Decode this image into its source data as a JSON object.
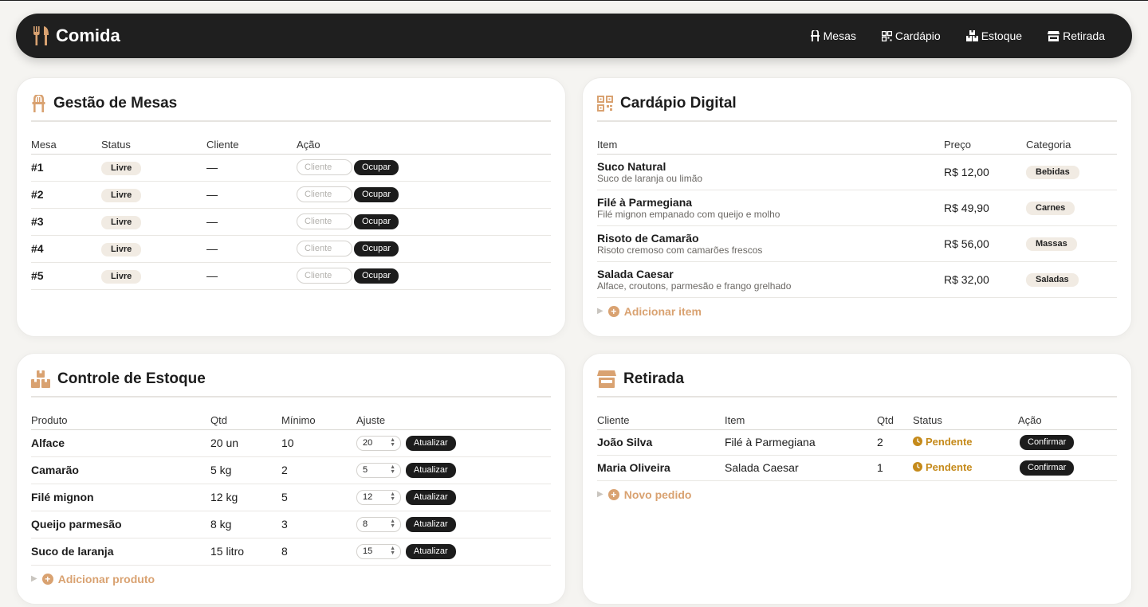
{
  "colors": {
    "accent": "#d9a271",
    "nav_bg": "#1f1f1f",
    "pending": "#c58a1a"
  },
  "nav": {
    "brand": "Comida",
    "links": [
      {
        "label": "Mesas",
        "icon": "chair-icon"
      },
      {
        "label": "Cardápio",
        "icon": "qr-grid-icon"
      },
      {
        "label": "Estoque",
        "icon": "boxes-icon"
      },
      {
        "label": "Retirada",
        "icon": "store-icon"
      }
    ]
  },
  "mesas": {
    "title": "Gestão de Mesas",
    "headers": [
      "Mesa",
      "Status",
      "Cliente",
      "Ação"
    ],
    "placeholder": "Cliente",
    "button": "Ocupar",
    "rows": [
      {
        "mesa": "#1",
        "status": "Livre",
        "cliente": "—"
      },
      {
        "mesa": "#2",
        "status": "Livre",
        "cliente": "—"
      },
      {
        "mesa": "#3",
        "status": "Livre",
        "cliente": "—"
      },
      {
        "mesa": "#4",
        "status": "Livre",
        "cliente": "—"
      },
      {
        "mesa": "#5",
        "status": "Livre",
        "cliente": "—"
      }
    ]
  },
  "cardapio": {
    "title": "Cardápio Digital",
    "headers": [
      "Item",
      "Preço",
      "Categoria"
    ],
    "add": "Adicionar item",
    "rows": [
      {
        "name": "Suco Natural",
        "desc": "Suco de laranja ou limão",
        "price": "R$ 12,00",
        "category": "Bebidas"
      },
      {
        "name": "Filé à Parmegiana",
        "desc": "Filé mignon empanado com queijo e molho",
        "price": "R$ 49,90",
        "category": "Carnes"
      },
      {
        "name": "Risoto de Camarão",
        "desc": "Risoto cremoso com camarões frescos",
        "price": "R$ 56,00",
        "category": "Massas"
      },
      {
        "name": "Salada Caesar",
        "desc": "Alface, croutons, parmesão e frango grelhado",
        "price": "R$ 32,00",
        "category": "Saladas"
      }
    ]
  },
  "estoque": {
    "title": "Controle de Estoque",
    "headers": [
      "Produto",
      "Qtd",
      "Mínimo",
      "Ajuste"
    ],
    "button": "Atualizar",
    "add": "Adicionar produto",
    "rows": [
      {
        "produto": "Alface",
        "qtd": "20 un",
        "minimo": "10",
        "ajuste": "20"
      },
      {
        "produto": "Camarão",
        "qtd": "5 kg",
        "minimo": "2",
        "ajuste": "5"
      },
      {
        "produto": "Filé mignon",
        "qtd": "12 kg",
        "minimo": "5",
        "ajuste": "12"
      },
      {
        "produto": "Queijo parmesão",
        "qtd": "8 kg",
        "minimo": "3",
        "ajuste": "8"
      },
      {
        "produto": "Suco de laranja",
        "qtd": "15 litro",
        "minimo": "8",
        "ajuste": "15"
      }
    ]
  },
  "retirada": {
    "title": "Retirada",
    "headers": [
      "Cliente",
      "Item",
      "Qtd",
      "Status",
      "Ação"
    ],
    "button": "Confirmar",
    "add": "Novo pedido",
    "rows": [
      {
        "cliente": "João Silva",
        "item": "Filé à Parmegiana",
        "qtd": "2",
        "status": "Pendente"
      },
      {
        "cliente": "Maria Oliveira",
        "item": "Salada Caesar",
        "qtd": "1",
        "status": "Pendente"
      }
    ]
  }
}
